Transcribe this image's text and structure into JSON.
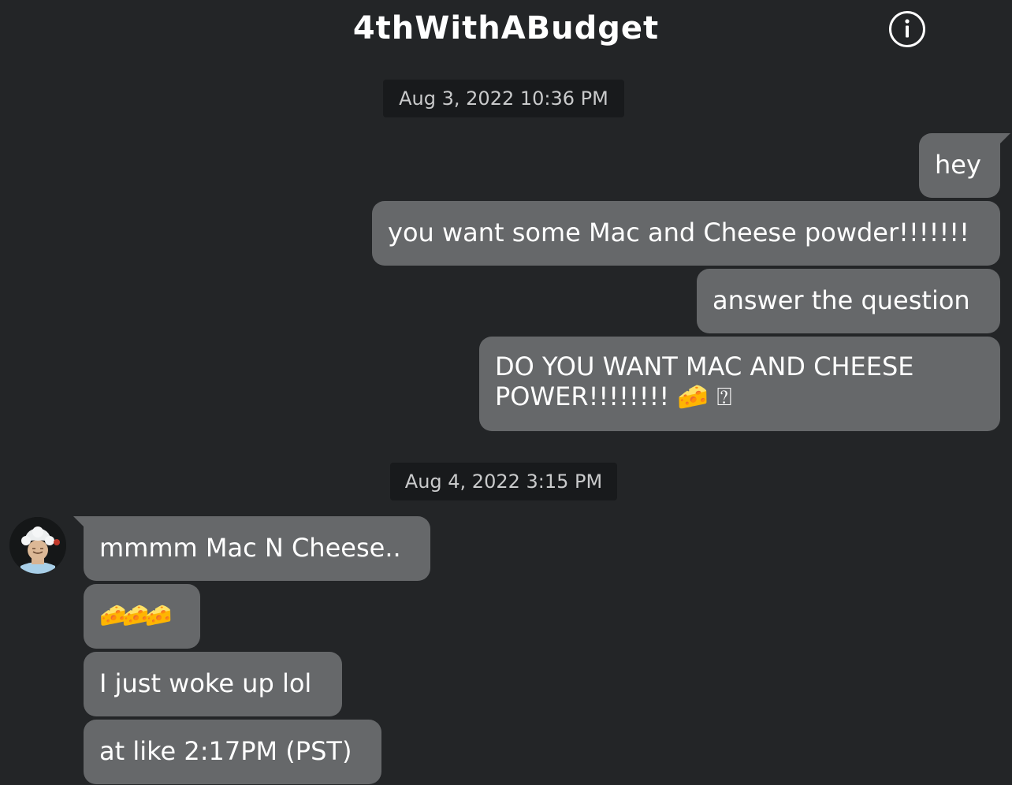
{
  "header": {
    "title": "4thWithABudget",
    "info_icon": "info-circle-icon"
  },
  "conversation": {
    "groups": [
      {
        "timestamp": "Aug 3, 2022 10:36 PM",
        "sender": "self",
        "messages": [
          "hey",
          "you want some Mac and Cheese powder!!!!!!!",
          "answer the question",
          "DO YOU WANT MAC AND CHEESE POWER!!!!!!!! 🧀 ⍰"
        ]
      },
      {
        "timestamp": "Aug 4, 2022 3:15 PM",
        "sender": "other",
        "avatar_icon": "user-avatar-icon",
        "messages": [
          "mmmm Mac N Cheese..",
          "🧀🧀🧀",
          "I just woke up lol",
          "at like 2:17PM (PST)"
        ]
      }
    ]
  },
  "colors": {
    "background": "#232527",
    "bubble": "#66686a",
    "timestamp_bg": "#181a1c",
    "timestamp_text": "#c9cacb",
    "text": "#ffffff"
  }
}
